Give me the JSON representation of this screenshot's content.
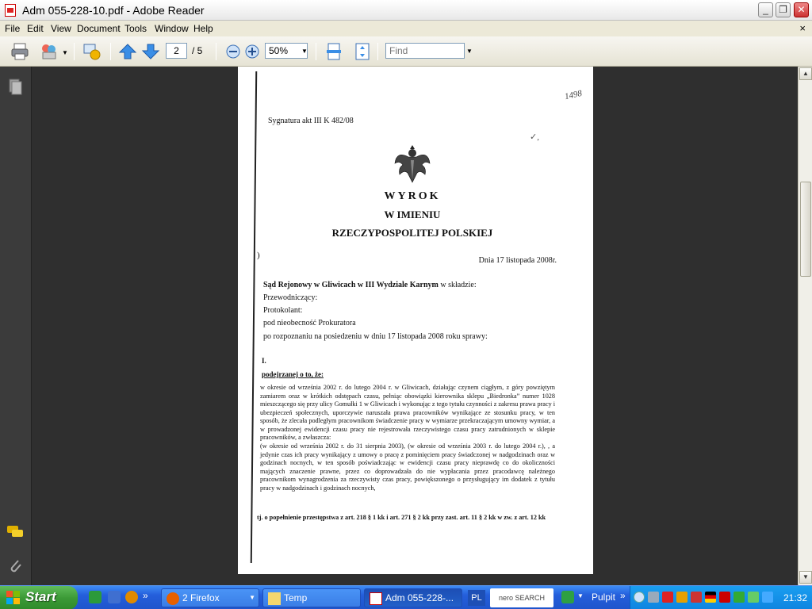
{
  "window": {
    "title": "Adm 055-228-10.pdf - Adobe Reader",
    "controls": {
      "minimize": "_",
      "restore": "❐",
      "close": "✕"
    }
  },
  "menu": {
    "items": [
      "File",
      "Edit",
      "View",
      "Document",
      "Tools",
      "Window",
      "Help"
    ],
    "close_doc": "×"
  },
  "toolbar": {
    "page_current": "2",
    "page_total": "/ 5",
    "zoom_value": "50%",
    "find_placeholder": "Find"
  },
  "document": {
    "signature": "Sygnatura akt III K 482/08",
    "handwritten_note": "1498",
    "margin_note": "✓,",
    "title_line1": "WYROK",
    "title_line2": "W IMIENIU",
    "title_line3": "RZECZYPOSPOLITEJ POLSKIEJ",
    "bracket_left": ")",
    "date_line": "Dnia 17 listopada 2008r.",
    "court_bold": "Sąd Rejonowy w Gliwicach w III Wydziale Karnym",
    "court_rest": " w składzie:",
    "line_chair": "Przewodniczący:",
    "line_clerk": "Protokolant:",
    "line_prosecutor": "pod nieobecność Prokuratora",
    "line_hearing": "po rozpoznaniu na posiedzeniu w dniu 17 listopada 2008 roku sprawy:",
    "roman_one": "I.",
    "accused_heading": "podejrzanej o to, że:",
    "paragraph_main": "w okresie od września 2002 r. do lutego 2004 r. w Gliwicach, działając czynem ciągłym, z góry powziętym zamiarem oraz w krótkich odstępach czasu, pełniąc obowiązki kierownika sklepu „Biedronka” numer 1028 mieszczącego się przy ulicy Gomułki 1 w Gliwicach i wykonując z tego tytułu czynności z zakresu prawa pracy i ubezpieczeń społecznych, uporczywie naruszała prawa pracowników wynikające ze stosunku pracy, w ten sposób, że zlecała podległym pracownikom świadczenie pracy w wymiarze przekraczającym umowny wymiar, a w prowadzonej ewidencji czasu pracy nie rejestrowała rzeczywistego czasu pracy zatrudnionych w sklepie pracowników, a zwłaszcza:",
    "paragraph_second": "(w okresie od września 2002 r. do 31 sierpnia 2003), (w okresie od września 2003 r. do lutego 2004 r.), , a jedynie czas ich pracy wynikający z umowy o pracę z pominięciem pracy świadczonej w nadgodzinach oraz w godzinach nocnych, w ten sposób poświadczając w ewidencji czasu pracy nieprawdę co do okoliczności mających znaczenie prawne, przez co doprowadzała do nie wypłacania przez pracodawcę należnego pracownikom wynagrodzenia za rzeczywisty czas pracy, powiększonego o przysługujący im dodatek z tytułu pracy w nadgodzinach i godzinach nocnych,",
    "paragraph_charge": "tj. o popełnienie przestępstwa z art. 218 § 1 kk i art. 271 § 2 kk przy zast. art. 11 § 2 kk w zw. z art. 12 kk"
  },
  "taskbar": {
    "start_label": "Start",
    "tasks": [
      {
        "label": "2 Firefox",
        "icon": "firefox-icon"
      },
      {
        "label": "Temp",
        "icon": "folder-icon"
      },
      {
        "label": "Adm 055-228-...",
        "icon": "pdf-icon"
      }
    ],
    "language": "PL",
    "nero_label": "nero SEARCH",
    "desk_label": "Pulpit",
    "clock": "21:32"
  },
  "colors": {
    "doc_bg": "#2f2f2f",
    "taskbar_blue": "#245edb",
    "start_green": "#3c9a37",
    "tray_blue": "#0e84e0"
  }
}
